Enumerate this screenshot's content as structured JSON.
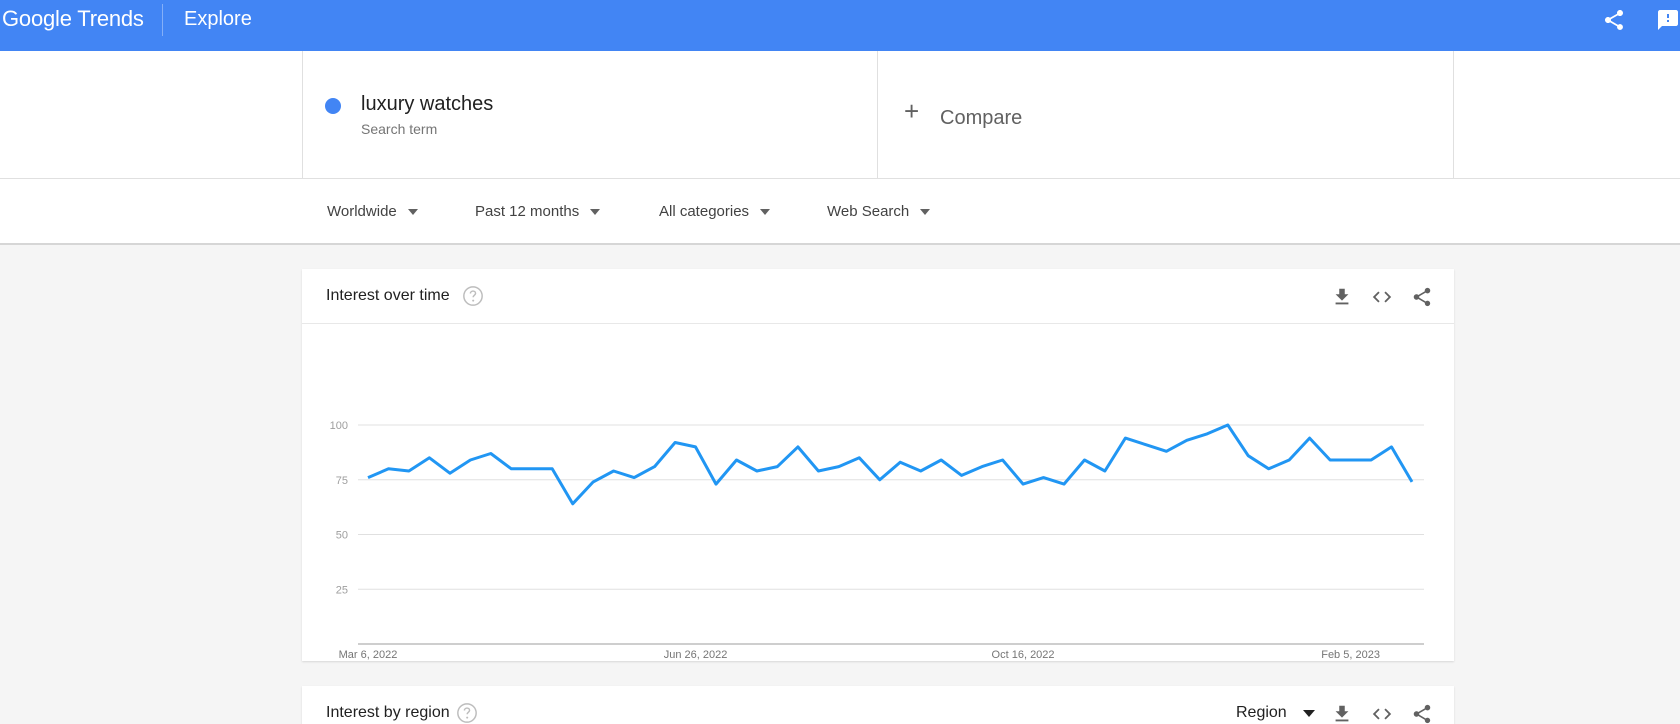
{
  "header": {
    "logo_google": "Google",
    "logo_trends": "Trends",
    "page": "Explore",
    "icons": [
      "share-icon",
      "feedback-icon"
    ]
  },
  "search": {
    "term": "luxury watches",
    "term_type": "Search term",
    "term_color": "#4285f4",
    "compare_label": "Compare"
  },
  "filters": {
    "location": "Worldwide",
    "time": "Past 12 months",
    "category": "All categories",
    "property": "Web Search"
  },
  "interest_over_time": {
    "title": "Interest over time",
    "icons": [
      "help-icon",
      "download-icon",
      "embed-icon",
      "share-icon"
    ]
  },
  "interest_by_region": {
    "title": "Interest by region",
    "select_value": "Region",
    "icons": [
      "help-icon",
      "download-icon",
      "embed-icon",
      "share-icon"
    ]
  },
  "chart_data": {
    "type": "line",
    "series": [
      {
        "name": "luxury watches",
        "color": "#2196f3",
        "values": [
          76,
          80,
          79,
          85,
          78,
          84,
          87,
          80,
          80,
          80,
          64,
          74,
          79,
          76,
          81,
          92,
          90,
          73,
          84,
          79,
          81,
          90,
          79,
          81,
          85,
          75,
          83,
          79,
          84,
          77,
          81,
          84,
          73,
          76,
          73,
          84,
          79,
          94,
          91,
          88,
          93,
          96,
          100,
          86,
          80,
          84,
          94,
          84,
          84,
          84,
          90,
          74
        ]
      }
    ],
    "x_tick_labels": [
      "Mar 6, 2022",
      "Jun 26, 2022",
      "Oct 16, 2022",
      "Feb 5, 2023"
    ],
    "x_tick_indices": [
      0,
      16,
      32,
      48
    ],
    "y_ticks": [
      25,
      50,
      75,
      100
    ],
    "ylim": [
      0,
      100
    ],
    "grid": true
  }
}
